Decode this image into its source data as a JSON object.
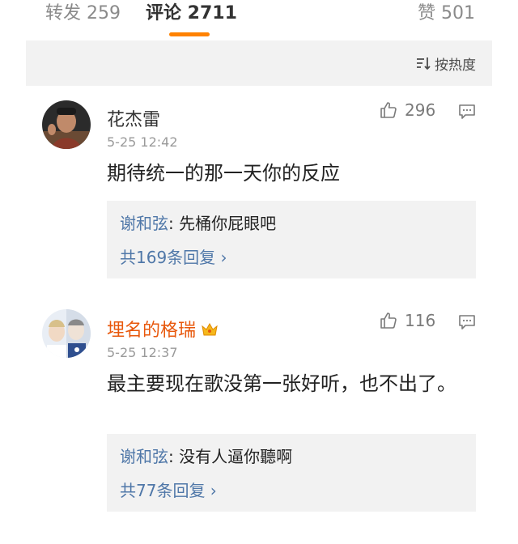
{
  "tabs": {
    "repost": "转发 259",
    "comments": "评论 2711",
    "likes": "赞 501"
  },
  "sort": {
    "label": "按热度",
    "icon": "sort-icon"
  },
  "colors": {
    "accent": "#ff8200",
    "link": "#4f77a8",
    "vip_name": "#e8580c"
  },
  "comments": [
    {
      "name": "花杰雷",
      "time": "5-25 12:42",
      "likes": "296",
      "text": "期待统一的那一天你的反应",
      "reply": {
        "author": "谢和弦",
        "sep": ": ",
        "content": "先桶你屁眼吧"
      },
      "more": "共169条回复 ›"
    },
    {
      "name": "埋名的格瑞",
      "time": "5-25 12:37",
      "likes": "116",
      "text": "最主要现在歌没第一张好听，也不出了。",
      "reply": {
        "author": "谢和弦",
        "sep": ": ",
        "content": "没有人逼你聽啊"
      },
      "more": "共77条回复 ›"
    }
  ]
}
